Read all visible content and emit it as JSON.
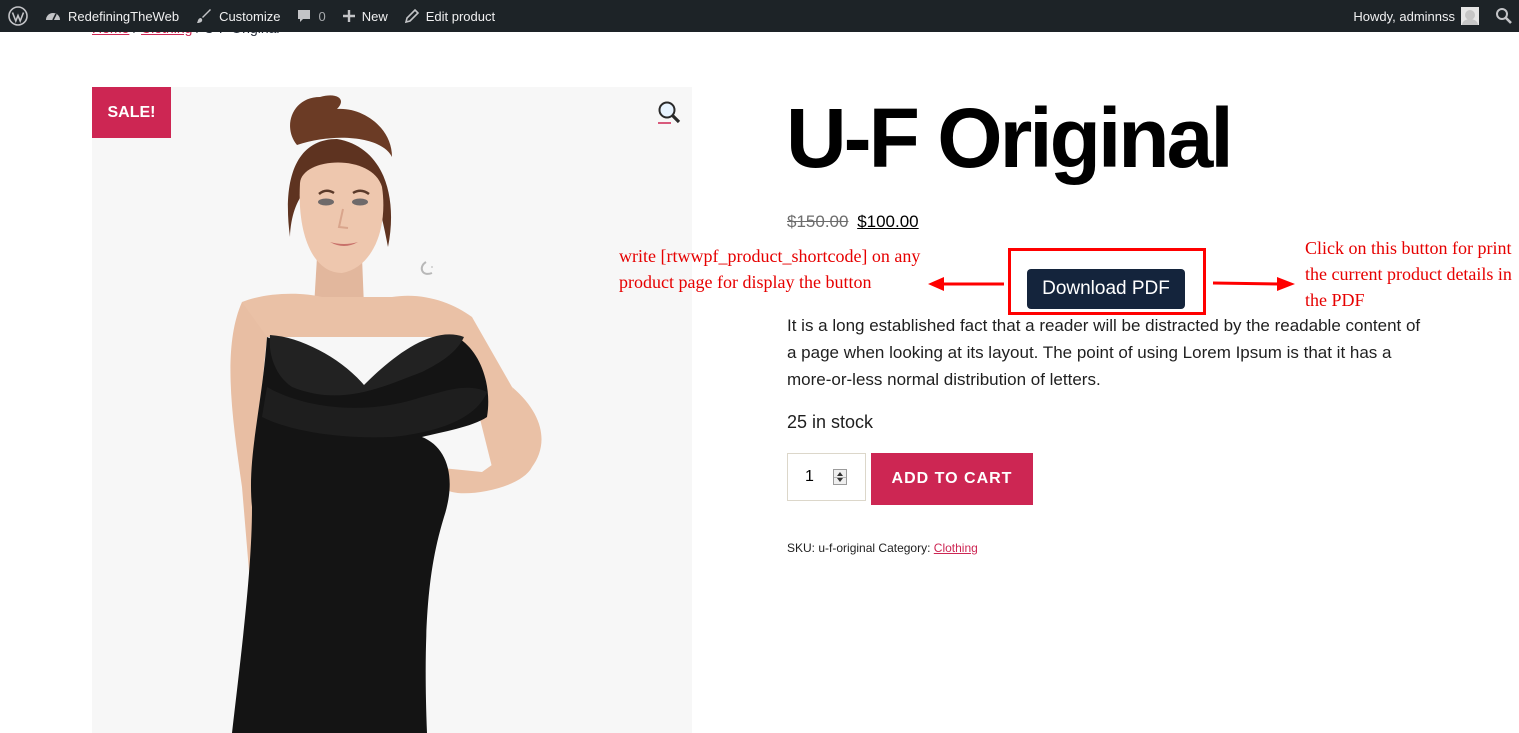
{
  "adminbar": {
    "site_name": "RedefiningTheWeb",
    "customize": "Customize",
    "comments_count": "0",
    "new": "New",
    "edit": "Edit product",
    "howdy": "Howdy, adminnss"
  },
  "breadcrumb": {
    "home": "Home",
    "sep1": " / ",
    "category": "Clothing",
    "sep2": " / ",
    "current": "U-F Original"
  },
  "product": {
    "sale_badge": "SALE!",
    "title": "U-F Original",
    "regular_price": "$150.00",
    "sale_price": "$100.00",
    "download_button": "Download PDF",
    "description": "It is a long established fact that a reader will be distracted by the readable content of a page when looking at its layout. The point of using Lorem Ipsum is that it has a more-or-less normal distribution of letters.",
    "stock": "25 in stock",
    "quantity": "1",
    "add_to_cart": "ADD TO CART",
    "sku_label": "SKU:",
    "sku": "u-f-original",
    "category_label": "Category:",
    "category": "Clothing"
  },
  "annotations": {
    "left": "write [rtwwpf_product_shortcode] on any product page for display the button",
    "right": "Click on this button for print the current product details in the PDF"
  },
  "colors": {
    "accent": "#cd2653",
    "admin_bar": "#1d2327",
    "download_button": "#14243c",
    "annotation": "#e60000"
  }
}
